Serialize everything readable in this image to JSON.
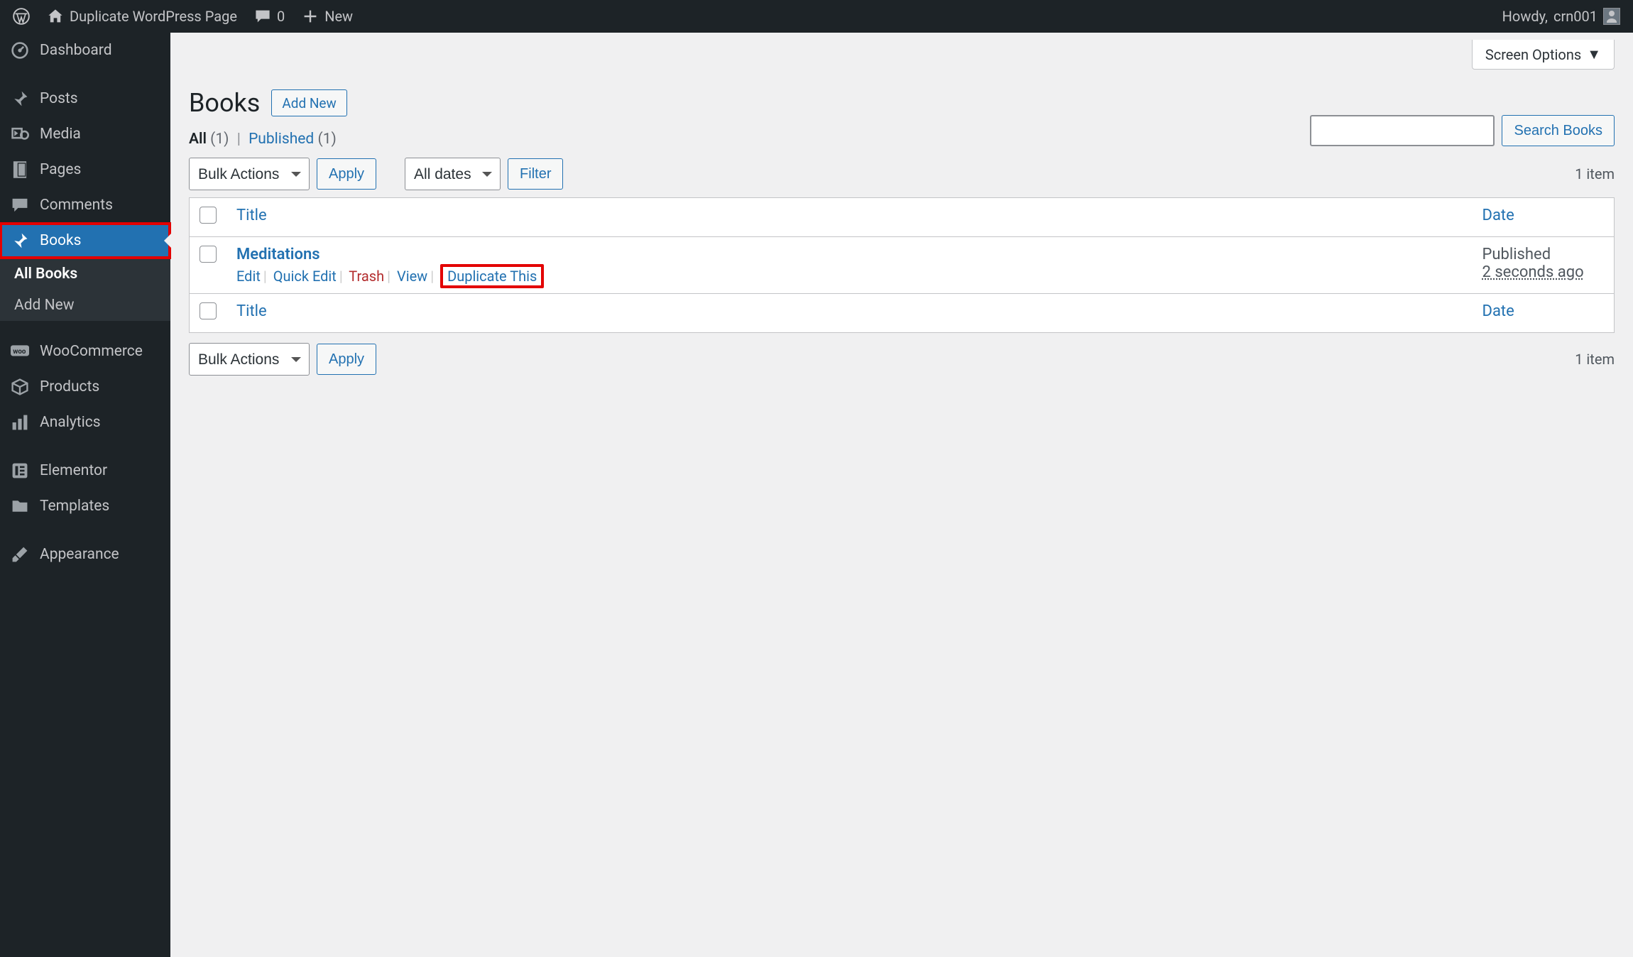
{
  "adminbar": {
    "site_title": "Duplicate WordPress Page",
    "comments_count": "0",
    "new_label": "New",
    "howdy": "Howdy,",
    "username": "crn001"
  },
  "sidebar": {
    "items": [
      {
        "icon": "dashboard",
        "label": "Dashboard"
      },
      {
        "icon": "pin",
        "label": "Posts"
      },
      {
        "icon": "media",
        "label": "Media"
      },
      {
        "icon": "page",
        "label": "Pages"
      },
      {
        "icon": "comment",
        "label": "Comments"
      },
      {
        "icon": "pin",
        "label": "Books"
      },
      {
        "icon": "woo",
        "label": "WooCommerce"
      },
      {
        "icon": "product",
        "label": "Products"
      },
      {
        "icon": "chart",
        "label": "Analytics"
      },
      {
        "icon": "elementor",
        "label": "Elementor"
      },
      {
        "icon": "folder",
        "label": "Templates"
      },
      {
        "icon": "brush",
        "label": "Appearance"
      }
    ],
    "submenu": {
      "items": [
        {
          "label": "All Books"
        },
        {
          "label": "Add New"
        }
      ]
    }
  },
  "screen_options_label": "Screen Options",
  "heading": "Books",
  "add_new_btn": "Add New",
  "views": {
    "all_label": "All",
    "all_count": "(1)",
    "published_label": "Published",
    "published_count": "(1)"
  },
  "bulk_actions_label": "Bulk Actions",
  "apply_label": "Apply",
  "all_dates_label": "All dates",
  "filter_label": "Filter",
  "items_count_label": "1 item",
  "search_btn": "Search Books",
  "columns": {
    "title": "Title",
    "date": "Date"
  },
  "rows": [
    {
      "title": "Meditations",
      "status": "Published",
      "timeago": "2 seconds ago",
      "actions": {
        "edit": "Edit",
        "quick_edit": "Quick Edit",
        "trash": "Trash",
        "view": "View",
        "duplicate": "Duplicate This"
      }
    }
  ]
}
